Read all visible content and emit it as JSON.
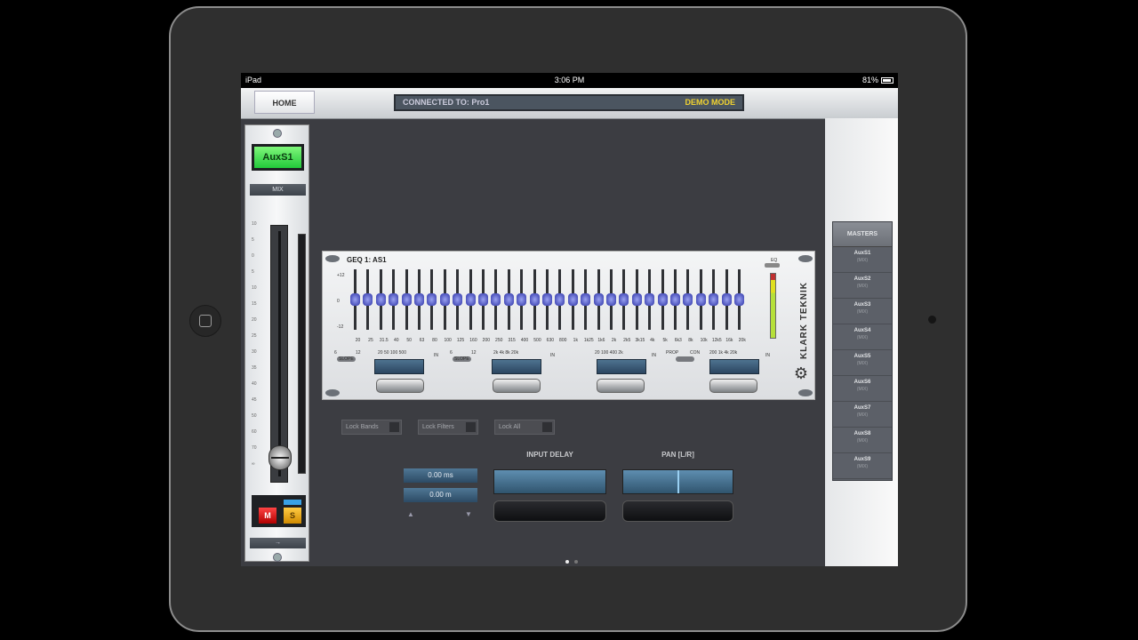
{
  "status": {
    "device": "iPad",
    "time": "3:06 PM",
    "battery": "81%"
  },
  "topbar": {
    "home": "HOME",
    "connected": "CONNECTED TO: Pro1",
    "demo": "DEMO MODE"
  },
  "channel": {
    "name": "AuxS1",
    "mode": "MIX",
    "mute": "M",
    "solo": "S",
    "footer": "→",
    "scale": [
      "10",
      "5",
      "0",
      "5",
      "10",
      "15",
      "20",
      "25",
      "30",
      "35",
      "40",
      "45",
      "50",
      "60",
      "70",
      "∞"
    ]
  },
  "geq": {
    "title": "GEQ 1: AS1",
    "scale": [
      "+12",
      "0",
      "-12"
    ],
    "bands": [
      "20",
      "25",
      "31.5",
      "40",
      "50",
      "63",
      "80",
      "100",
      "125",
      "160",
      "200",
      "250",
      "315",
      "400",
      "500",
      "630",
      "800",
      "1k",
      "1k25",
      "1k6",
      "2k",
      "2k5",
      "3k15",
      "4k",
      "5k",
      "6k3",
      "8k",
      "10k",
      "12k5",
      "16k",
      "20k"
    ],
    "eq_label": "EQ",
    "brand": "KLARK TEKNIK",
    "filters": [
      {
        "slope": "SLOPE",
        "left_val": "6",
        "right_val": "12",
        "ticks": "20 50 100 500",
        "in": "IN"
      },
      {
        "slope": "SLOPE",
        "left_val": "6",
        "right_val": "12",
        "ticks": "2k 4k 8k 20k",
        "in": "IN"
      },
      {
        "slope": "",
        "left_val": "",
        "right_val": "",
        "ticks": "20 100 400 2k",
        "in": "IN"
      },
      {
        "slope": "PROP",
        "left_val": "CON",
        "right_val": "",
        "ticks": "200 1k 4k 20k",
        "in": "IN"
      }
    ]
  },
  "locks": {
    "bands": "Lock Bands",
    "filters": "Lock Filters",
    "all": "Lock All"
  },
  "delay": {
    "title": "INPUT DELAY",
    "ms": "0.00 ms",
    "m": "0.00 m",
    "up": "▲",
    "down": "▼"
  },
  "pan": {
    "title": "PAN [L/R]"
  },
  "masters": {
    "title": "MASTERS",
    "items": [
      {
        "name": "AuxS1",
        "sub": "(MIX)"
      },
      {
        "name": "AuxS2",
        "sub": "(MIX)"
      },
      {
        "name": "AuxS3",
        "sub": "(MIX)"
      },
      {
        "name": "AuxS4",
        "sub": "(MIX)"
      },
      {
        "name": "AuxS5",
        "sub": "(MIX)"
      },
      {
        "name": "AuxS6",
        "sub": "(MIX)"
      },
      {
        "name": "AuxS7",
        "sub": "(MIX)"
      },
      {
        "name": "AuxS8",
        "sub": "(MIX)"
      },
      {
        "name": "AuxS9",
        "sub": "(MIX)"
      }
    ]
  },
  "colors": {
    "accent_green": "#3ed84a",
    "demo_yellow": "#f1d330",
    "band_knob": "#3b43c4"
  }
}
